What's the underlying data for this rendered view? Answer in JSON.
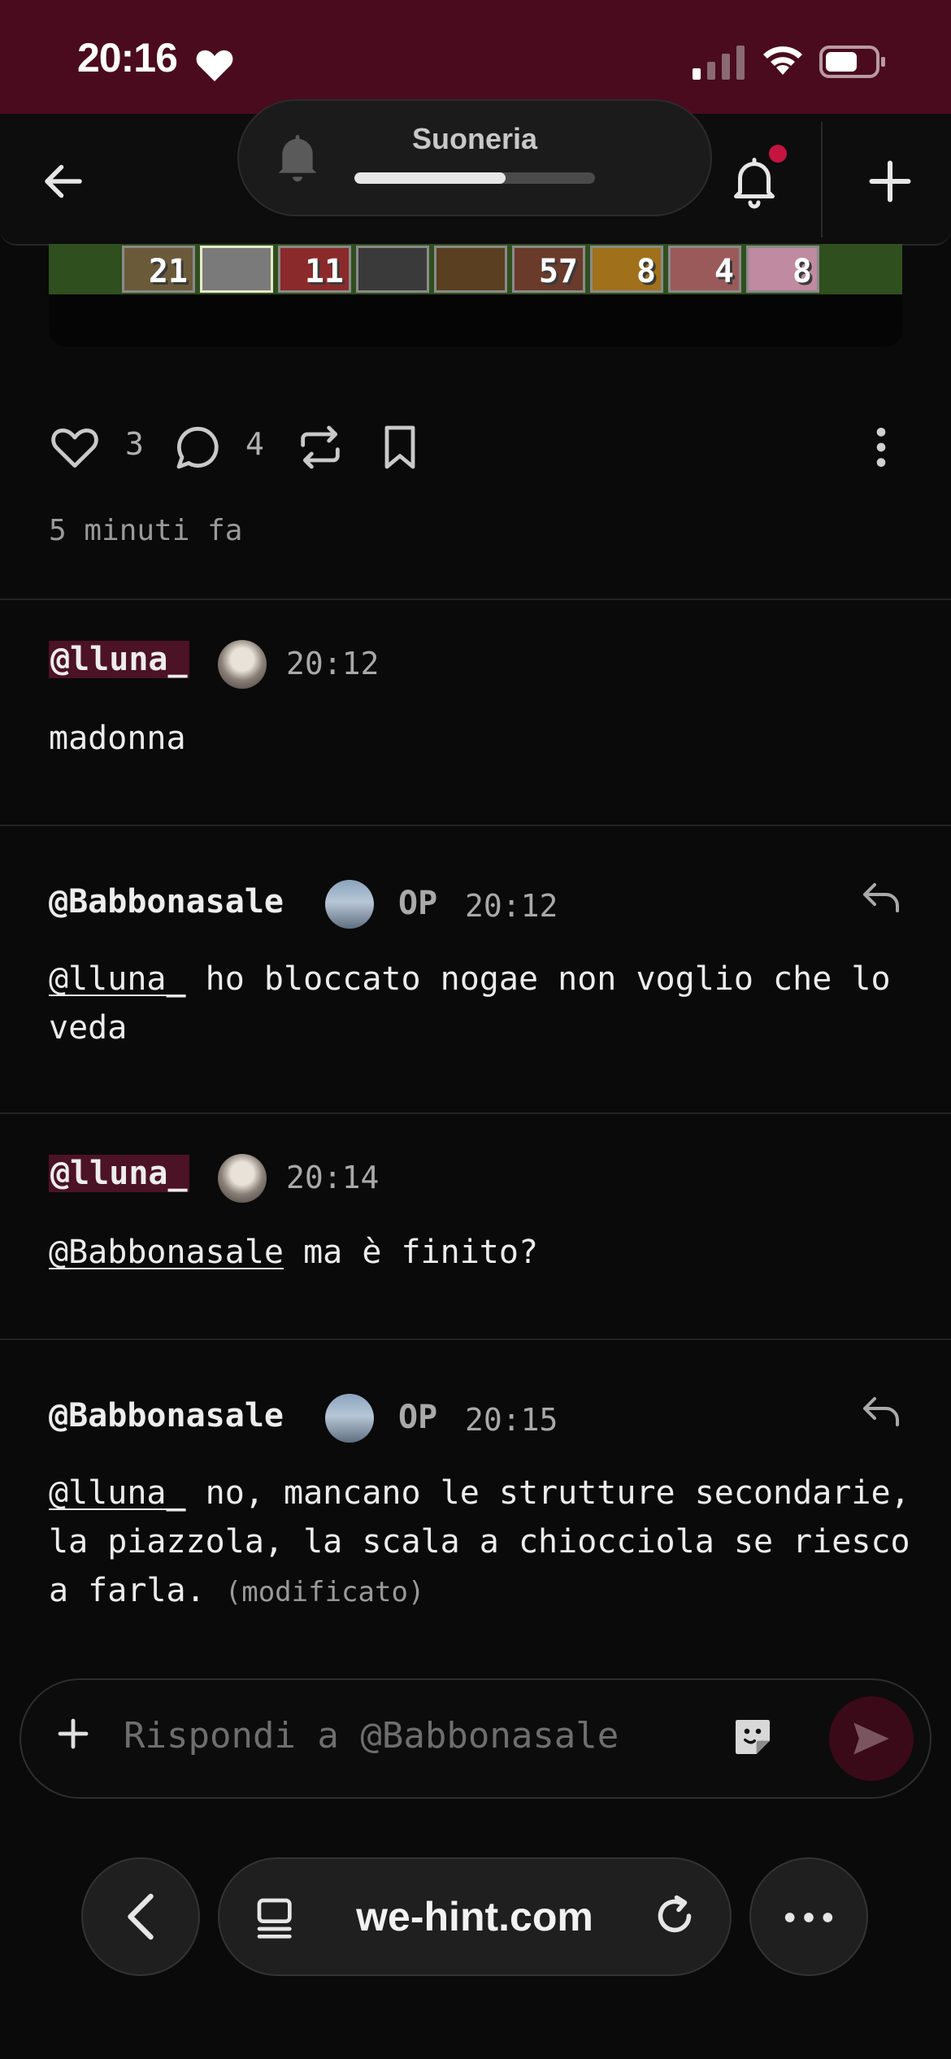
{
  "status_bar": {
    "time": "20:16",
    "heart_icon": "heart-icon",
    "signal_icon": "cellular-signal-icon",
    "wifi_icon": "wifi-icon",
    "battery_icon": "battery-icon"
  },
  "header": {
    "back_icon": "arrow-left-icon",
    "notifications_icon": "bell-icon",
    "notification_dot_color": "#c4143f",
    "new_post_icon": "plus-icon"
  },
  "volume_toast": {
    "label": "Suoneria",
    "icon": "bell-icon",
    "level": 0.63
  },
  "post": {
    "image_hotbar_counts": [
      "21",
      "",
      "11",
      "",
      "",
      "57",
      "8",
      "4",
      "8"
    ],
    "likes": "3",
    "comments": "4",
    "posted_ago": "5 minuti fa",
    "icons": {
      "like": "heart-outline-icon",
      "comment": "comment-bubble-icon",
      "repost": "repost-icon",
      "bookmark": "bookmark-icon",
      "more": "more-vertical-icon"
    }
  },
  "comments": [
    {
      "username": "@lluna_",
      "highlighted": true,
      "op": "",
      "time": "20:12",
      "mention": "",
      "text": "madonna",
      "edited": ""
    },
    {
      "username": "@Babbonasale",
      "highlighted": false,
      "op": "OP",
      "time": "20:12",
      "mention": "@lluna_",
      "text": " ho bloccato nogae non voglio che lo veda",
      "edited": ""
    },
    {
      "username": "@lluna_",
      "highlighted": true,
      "op": "",
      "time": "20:14",
      "mention": "@Babbonasale",
      "text": " ma è finito?",
      "edited": ""
    },
    {
      "username": "@Babbonasale",
      "highlighted": false,
      "op": "OP",
      "time": "20:15",
      "mention": "@lluna_",
      "text": " no, mancano le strutture secondarie, la piazzola, la scala a chiocciola se riesco a farla.",
      "edited": "(modificato)"
    }
  ],
  "reply_bar": {
    "placeholder": "Rispondi a @Babbonasale",
    "attach_icon": "plus-icon",
    "sticker_icon": "sticker-icon",
    "send_icon": "send-icon"
  },
  "browser": {
    "url": "we-hint.com",
    "back_icon": "chevron-left-icon",
    "tabs_icon": "tabs-icon",
    "reload_icon": "reload-icon",
    "more_icon": "more-horizontal-icon"
  },
  "colors": {
    "status_bar_bg": "#4a0b1e",
    "mention_highlight": "#4c1225",
    "background": "#0a0a0a"
  }
}
